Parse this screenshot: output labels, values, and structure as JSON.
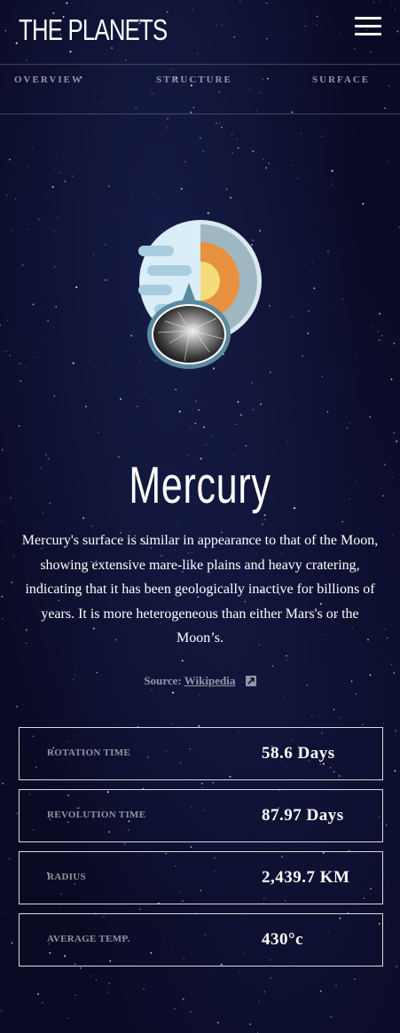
{
  "header": {
    "logo": "THE PLANETS",
    "menu_icon": "hamburger-menu-icon"
  },
  "tabs": [
    {
      "label": "OVERVIEW"
    },
    {
      "label": "STRUCTURE"
    },
    {
      "label": "SURFACE"
    }
  ],
  "planet": {
    "name": "Mercury",
    "description": "Mercury's surface is similar in appearance to that of the Moon, showing extensive mare-like plains and heavy cratering, indicating that it has been geologically inactive for billions of years. It is more heterogeneous than either Mars's or the Moon’s.",
    "source_label": "Source:",
    "source_link": "Wikipedia",
    "source_icon": "external-link-icon"
  },
  "stats": [
    {
      "label": "ROTATION TIME",
      "value": "58.6 Days"
    },
    {
      "label": "REVOLUTION TIME",
      "value": "87.97 Days"
    },
    {
      "label": "RADIUS",
      "value": "2,439.7 KM"
    },
    {
      "label": "AVERAGE TEMP.",
      "value": "430°c"
    }
  ],
  "colors": {
    "background": "#090b25",
    "planet_light": "#d9eef8",
    "planet_cloud": "#a9cde0",
    "core_outer": "#e8913f",
    "core_inner": "#f4dc7c",
    "mantle": "#9fb7c2",
    "ring": "#5a8aa0"
  }
}
